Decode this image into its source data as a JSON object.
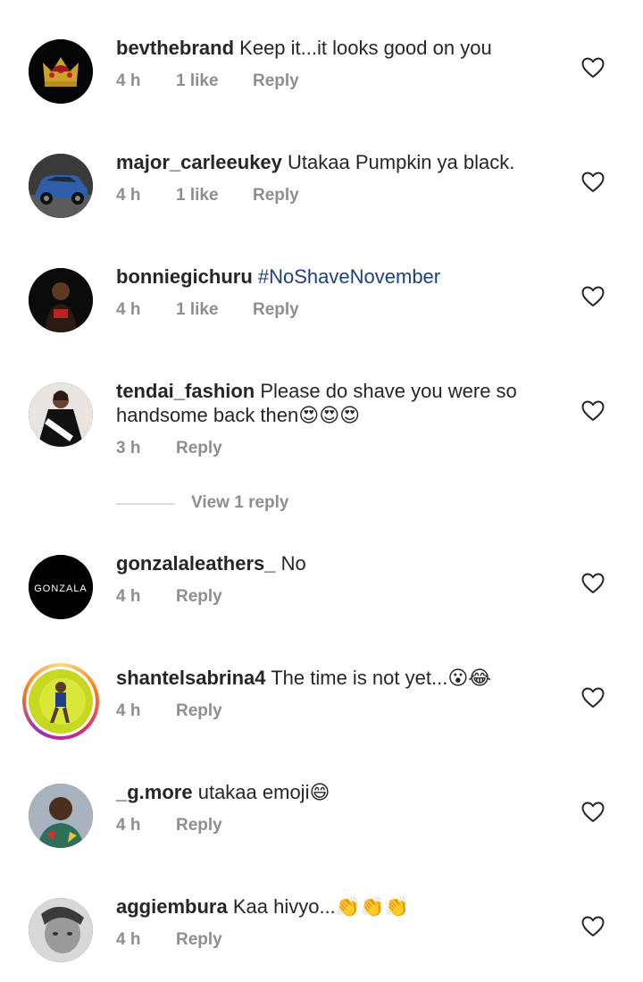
{
  "comments": [
    {
      "username": "bevthebrand",
      "text": "Keep it...it looks good on you",
      "time": "4 h",
      "likes": "1 like",
      "reply": "Reply"
    },
    {
      "username": "major_carleeukey",
      "text": "Utakaa Pumpkin ya black.",
      "time": "4 h",
      "likes": "1 like",
      "reply": "Reply"
    },
    {
      "username": "bonniegichuru",
      "text": "#NoShaveNovember",
      "time": "4 h",
      "likes": "1 like",
      "reply": "Reply"
    },
    {
      "username": "tendai_fashion",
      "text": "Please do shave you were so handsome back then",
      "emoji": "😍😍😍",
      "time": "3 h",
      "reply": "Reply"
    },
    {
      "username": "gonzalaleathers_",
      "text": "No",
      "avatar_text": "GONZALA",
      "time": "4 h",
      "reply": "Reply"
    },
    {
      "username": "shantelsabrina4",
      "text": "The time is not yet...",
      "emoji": "😮😂",
      "time": "4 h",
      "reply": "Reply"
    },
    {
      "username": "_g.more",
      "text": "utakaa emoji",
      "emoji": "😄",
      "time": "4 h",
      "reply": "Reply"
    },
    {
      "username": "aggiembura",
      "text": "Kaa hivyo...",
      "emoji": "👏👏👏",
      "time": "4 h",
      "reply": "Reply"
    }
  ],
  "view_replies": "View 1 reply",
  "icons": {
    "like": "heart-outline-icon"
  },
  "colors": {
    "text": "#262626",
    "secondary": "#8e8e8e",
    "hashtag": "#1f3f7a",
    "divider": "#dbdbdb"
  }
}
